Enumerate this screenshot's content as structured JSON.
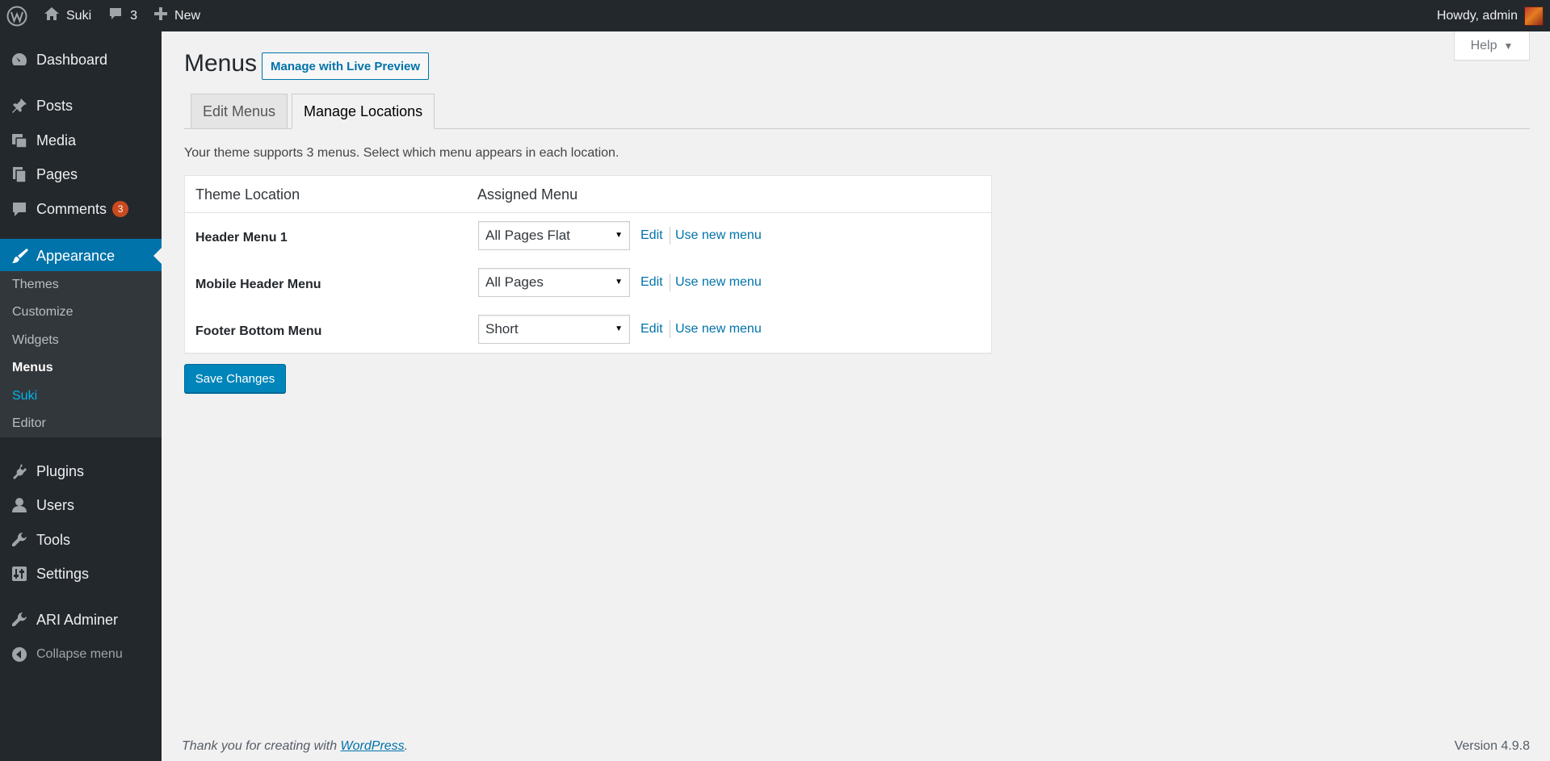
{
  "adminbar": {
    "site_name": "Suki",
    "comments_count": "3",
    "new_label": "New",
    "howdy": "Howdy, admin"
  },
  "sidebar": {
    "items": [
      {
        "label": "Dashboard",
        "icon": "dashboard-icon"
      },
      {
        "label": "Posts",
        "icon": "pin-icon"
      },
      {
        "label": "Media",
        "icon": "media-icon"
      },
      {
        "label": "Pages",
        "icon": "pages-icon"
      },
      {
        "label": "Comments",
        "icon": "comment-icon",
        "badge": "3"
      },
      {
        "label": "Appearance",
        "icon": "brush-icon"
      },
      {
        "label": "Plugins",
        "icon": "plugin-icon"
      },
      {
        "label": "Users",
        "icon": "user-icon"
      },
      {
        "label": "Tools",
        "icon": "wrench-icon"
      },
      {
        "label": "Settings",
        "icon": "settings-icon"
      },
      {
        "label": "ARI Adminer",
        "icon": "wrench-icon"
      }
    ],
    "submenu": [
      "Themes",
      "Customize",
      "Widgets",
      "Menus",
      "Suki",
      "Editor"
    ],
    "collapse_label": "Collapse menu"
  },
  "help_label": "Help",
  "page": {
    "title": "Menus",
    "live_preview": "Manage with Live Preview",
    "tabs": [
      "Edit Menus",
      "Manage Locations"
    ],
    "intro": "Your theme supports 3 menus. Select which menu appears in each location.",
    "table": {
      "headers": [
        "Theme Location",
        "Assigned Menu"
      ],
      "rows": [
        {
          "location": "Header Menu 1",
          "menu": "All Pages Flat",
          "edit": "Edit",
          "new": "Use new menu"
        },
        {
          "location": "Mobile Header Menu",
          "menu": "All Pages",
          "edit": "Edit",
          "new": "Use new menu"
        },
        {
          "location": "Footer Bottom Menu",
          "menu": "Short",
          "edit": "Edit",
          "new": "Use new menu"
        }
      ]
    },
    "save_label": "Save Changes"
  },
  "footer": {
    "thanks_prefix": "Thank you for creating with ",
    "wp_link": "WordPress",
    "thanks_suffix": ".",
    "version": "Version 4.9.8"
  },
  "colors": {
    "accent": "#0073aa",
    "sidebar_bg": "#23282d",
    "badge": "#ca4a1f",
    "primary_button": "#0085ba"
  }
}
